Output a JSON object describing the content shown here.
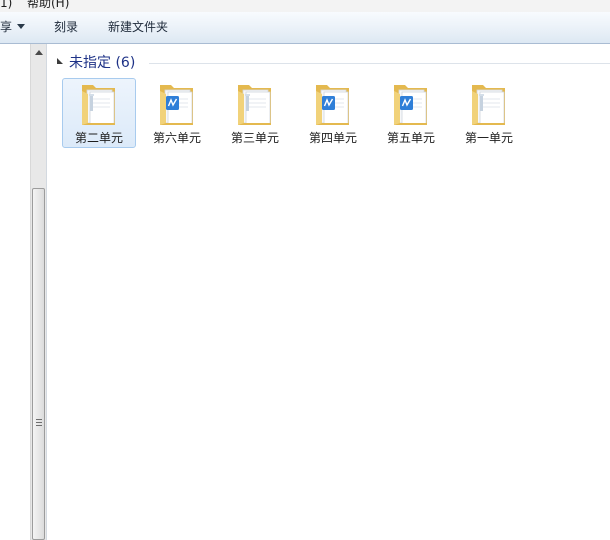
{
  "menubar": {
    "left_fragment": "1)",
    "help": "帮助(H)"
  },
  "toolbar": {
    "share_fragment": "享",
    "burn": "刻录",
    "new_folder": "新建文件夹"
  },
  "group": {
    "title": "未指定 (6)"
  },
  "items": [
    {
      "label": "第二单元",
      "selected": true,
      "badge": false
    },
    {
      "label": "第六单元",
      "selected": false,
      "badge": true
    },
    {
      "label": "第三单元",
      "selected": false,
      "badge": false
    },
    {
      "label": "第四单元",
      "selected": false,
      "badge": true
    },
    {
      "label": "第五单元",
      "selected": false,
      "badge": true
    },
    {
      "label": "第一单元",
      "selected": false,
      "badge": false
    }
  ],
  "icons": {
    "folder": "folder-icon",
    "badge": "document-app-icon"
  },
  "colors": {
    "folder_body": "#f1d27a",
    "folder_back": "#e4b94f",
    "badge_blue": "#2f7fd8",
    "group_title": "#1e3287",
    "selection": "#dceaf9"
  }
}
